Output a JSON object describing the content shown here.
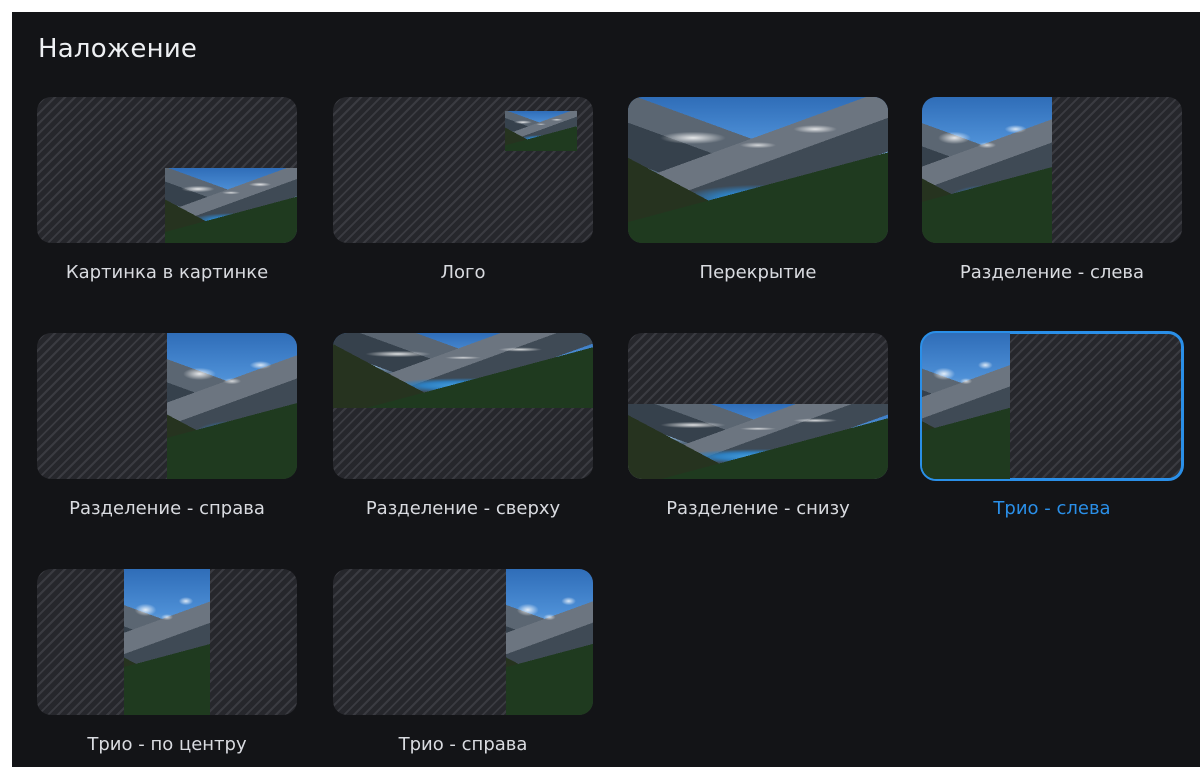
{
  "panel": {
    "title": "Наложение"
  },
  "tiles": [
    {
      "label": "Картинка в картинке"
    },
    {
      "label": "Лого"
    },
    {
      "label": "Перекрытие"
    },
    {
      "label": "Разделение - слева"
    },
    {
      "label": "Разделение - справа"
    },
    {
      "label": "Разделение - сверху"
    },
    {
      "label": "Разделение - снизу"
    },
    {
      "label": "Трио - слева",
      "selected": true
    },
    {
      "label": "Трио - по центру"
    },
    {
      "label": "Трио - справа"
    }
  ],
  "colors": {
    "background": "#131417",
    "accent": "#2a8fe8",
    "label": "#d9dbe0"
  }
}
